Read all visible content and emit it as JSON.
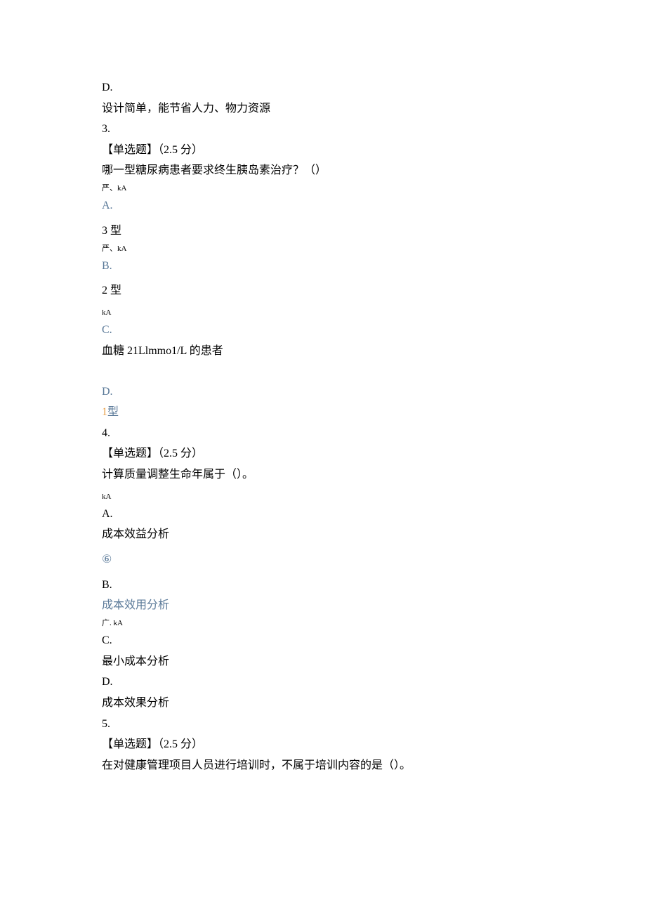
{
  "q2_partial": {
    "option_d_letter": "D.",
    "option_d_text": "设计简单，能节省人力、物力资源"
  },
  "q3": {
    "number": "3.",
    "type_label": "【单选题】",
    "points": "（2.5 分）",
    "question_text": "哪一型糖尿病患者要求终生胰岛素治疗？（）",
    "marker_a": "严、kA",
    "option_a_letter": "A.",
    "option_a_text": "3 型",
    "marker_b": "严、kA",
    "option_b_letter": "B.",
    "option_b_text": "2 型",
    "marker_c": "kA",
    "option_c_letter": "C.",
    "option_c_text": "血糖 21Llmmo1/L 的患者",
    "option_d_letter": "D.",
    "answer_num": "1",
    "answer_text": "型"
  },
  "q4": {
    "number": "4.",
    "type_label": "【单选题】",
    "points": "（2.5 分）",
    "question_text": "计算质量调整生命年属于（）。",
    "marker_a": "kA",
    "option_a_letter": "A.",
    "option_a_text": "成本效益分析",
    "circled": "⑥",
    "option_b_letter": "B.",
    "answer_text": "成本效用分析",
    "marker_c": "广. kA",
    "option_c_letter": "C.",
    "option_c_text": "最小成本分析",
    "option_d_letter": "D.",
    "option_d_text": "成本效果分析"
  },
  "q5": {
    "number": "5.",
    "type_label": "【单选题】",
    "points": "（2.5 分）",
    "question_text": "在对健康管理项目人员进行培训时，不属于培训内容的是（）。"
  }
}
